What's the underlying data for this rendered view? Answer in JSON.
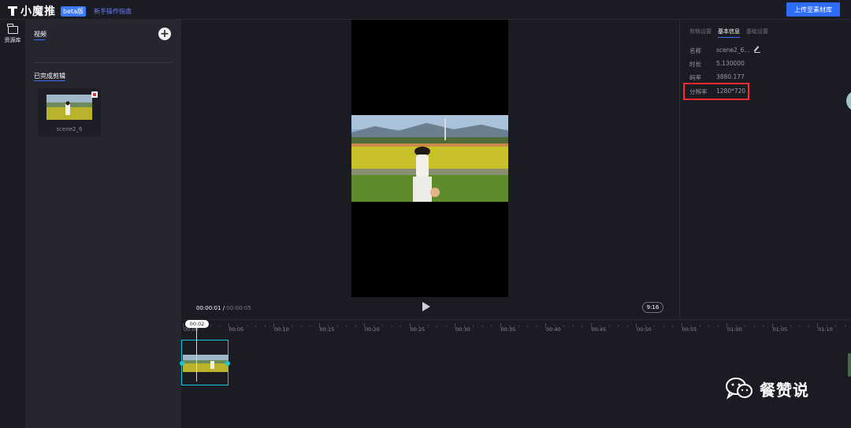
{
  "app": {
    "logo_text": "小魔推",
    "beta_badge": "beta版",
    "guide_link": "新手操作指南",
    "upload_button": "上传至素材库"
  },
  "nav": {
    "items": [
      {
        "label": "资源库",
        "icon": "folder-icon"
      }
    ]
  },
  "assets": {
    "tab_label": "视频",
    "add_icon": "plus-icon",
    "section_title": "已完成剪辑",
    "clips": [
      {
        "name": "scene2_6"
      }
    ]
  },
  "preview": {
    "current_time": "00:00:01",
    "separator": "/",
    "total_time": "00:00:05",
    "aspect_ratio": "9:16",
    "play_icon": "play-icon"
  },
  "properties": {
    "tabs": [
      {
        "label": "剪辑设置",
        "active": false
      },
      {
        "label": "基本信息",
        "active": true
      },
      {
        "label": "基础设置",
        "active": false
      }
    ],
    "rows": [
      {
        "label": "名称",
        "value": "scene2_6..."
      },
      {
        "label": "时长",
        "value": "5.130000"
      },
      {
        "label": "码率",
        "value": "3880.177"
      },
      {
        "label": "分辨率",
        "value": "1280*720"
      }
    ],
    "highlight_color": "#ff2a2a"
  },
  "timeline": {
    "playhead_label": "00:02",
    "ticks": [
      "00:00",
      "00:05",
      "00:10",
      "00:15",
      "00:20",
      "00:25",
      "00:30",
      "00:35",
      "00:40",
      "00:45",
      "00:50",
      "00:55",
      "01:00",
      "01:05",
      "01:10"
    ]
  },
  "watermark": {
    "text": "餐赞说"
  }
}
